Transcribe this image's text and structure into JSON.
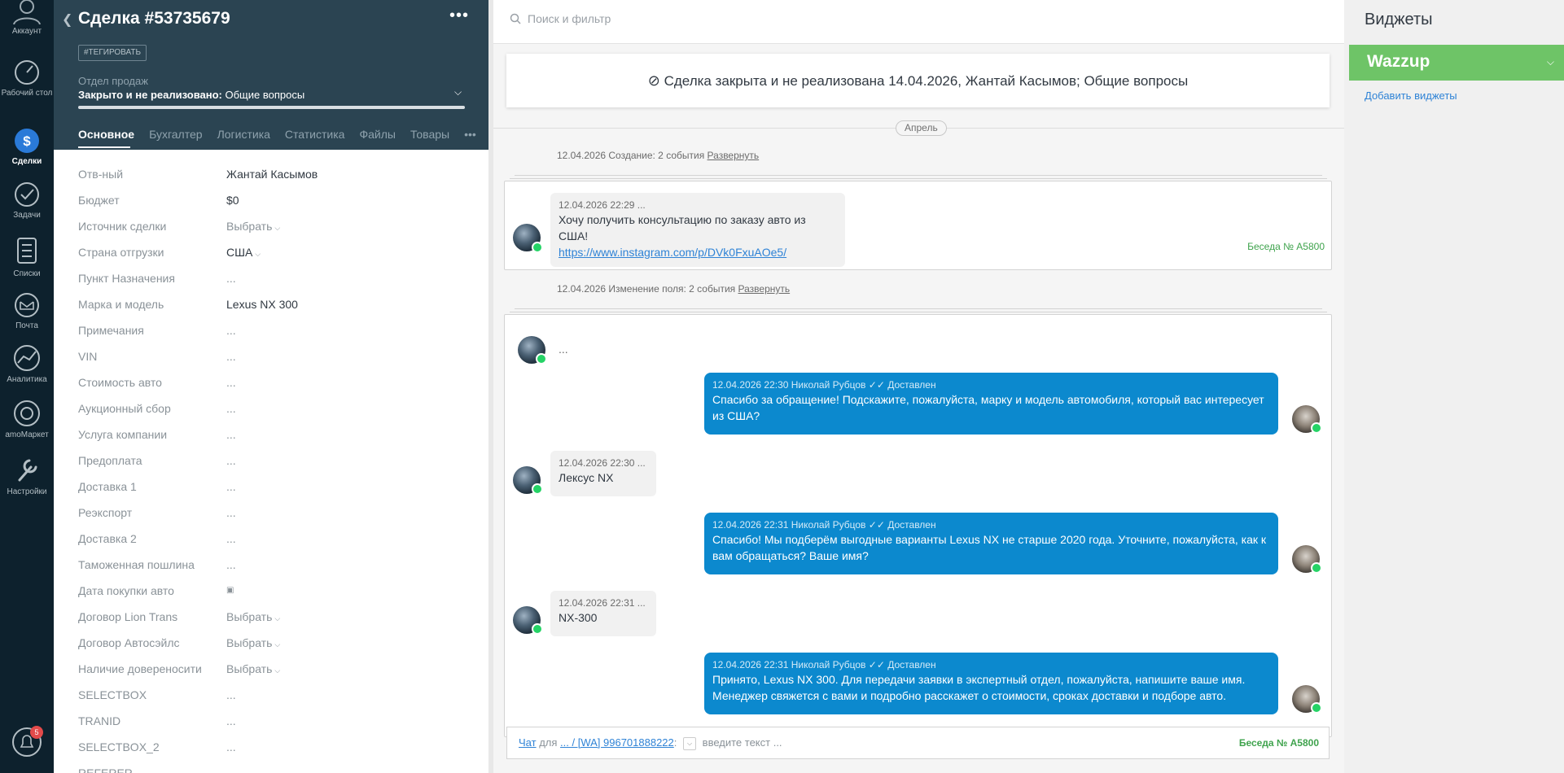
{
  "nav": {
    "items": [
      {
        "label": "Аккаунт"
      },
      {
        "label": "Рабочий стол"
      },
      {
        "label": "Сделки"
      },
      {
        "label": "Задачи"
      },
      {
        "label": "Списки"
      },
      {
        "label": "Почта"
      },
      {
        "label": "Аналитика"
      },
      {
        "label": "amoМаркет"
      },
      {
        "label": "Настройки"
      }
    ],
    "notifications_count": "5"
  },
  "card": {
    "title": "Сделка #53735679",
    "tag_button": "#ТЕГИРОВАТЬ",
    "pipeline": "Отдел продаж",
    "status_bold": "Закрыто и не реализовано:",
    "status_rest": " Общие вопросы",
    "tabs": [
      "Основное",
      "Бухгалтер",
      "Логистика",
      "Статистика",
      "Файлы",
      "Товары"
    ],
    "fields": [
      {
        "label": "Отв-ный",
        "value": "Жантай Касымов"
      },
      {
        "label": "Бюджет",
        "value": "$0"
      },
      {
        "label": "Источник сделки",
        "value": "Выбрать"
      },
      {
        "label": "Страна отгрузки",
        "value": "США"
      },
      {
        "label": "Пункт Назначения",
        "value": "..."
      },
      {
        "label": "Марка и модель",
        "value": "Lexus NX 300"
      },
      {
        "label": "Примечания",
        "value": "..."
      },
      {
        "label": "VIN",
        "value": "..."
      },
      {
        "label": "Стоимость авто",
        "value": "..."
      },
      {
        "label": "Аукционный сбор",
        "value": "..."
      },
      {
        "label": "Услуга компании",
        "value": "..."
      },
      {
        "label": "Предоплата",
        "value": "..."
      },
      {
        "label": "Доставка 1",
        "value": "..."
      },
      {
        "label": "Реэкспорт",
        "value": "..."
      },
      {
        "label": "Доставка 2",
        "value": "..."
      },
      {
        "label": "Таможенная пошлина",
        "value": "..."
      },
      {
        "label": "Дата покупки авто",
        "value": ""
      },
      {
        "label": "Договор Lion Trans",
        "value": "Выбрать"
      },
      {
        "label": "Договор Автосэйлс",
        "value": "Выбрать"
      },
      {
        "label": "Наличие довереносити",
        "value": "Выбрать"
      },
      {
        "label": "SELECTBOX",
        "value": "..."
      },
      {
        "label": "TRANID",
        "value": "..."
      },
      {
        "label": "SELECTBOX_2",
        "value": "..."
      },
      {
        "label": "REFERER",
        "value": ""
      }
    ]
  },
  "feed": {
    "search_placeholder": "Поиск и фильтр",
    "closed_banner": "Сделка закрыта и не реализована 14.04.2026, Жантай Касымов; Общие вопросы",
    "month": "Апрель",
    "summary1_text": "12.04.2026 Создание: 2 события",
    "summary2_text": "12.04.2026 Изменение поля: 2 события",
    "expand": "Развернуть",
    "conversation": "Беседа № A5800",
    "ellipsis": "...",
    "msg1": {
      "meta": "12.04.2026 22:29 ...",
      "text": "Хочу получить консультацию по заказу авто из США!",
      "link": "https://www.instagram.com/p/DVk0FxuAOe5/"
    },
    "out1": {
      "meta": "12.04.2026 22:30 Николай Рубцов",
      "status": "Доставлен",
      "text": "Спасибо за обращение! Подскажите, пожалуйста, марку и модель автомобиля, который вас интересует из США?"
    },
    "in2": {
      "meta": "12.04.2026 22:30 ...",
      "text": "Лексус NX"
    },
    "out2": {
      "meta": "12.04.2026 22:31 Николай Рубцов",
      "status": "Доставлен",
      "text": "Спасибо! Мы подберём выгодные варианты Lexus NX не старше 2020 года. Уточните, пожалуйста, как к вам обращаться? Ваше имя?"
    },
    "in3": {
      "meta": "12.04.2026 22:31 ...",
      "text": "NX-300"
    },
    "out3": {
      "meta": "12.04.2026 22:31 Николай Рубцов",
      "status": "Доставлен",
      "text": "Принято, Lexus NX 300. Для передачи заявки в экспертный отдел, пожалуйста, напишите ваше имя. Менеджер свяжется с вами и подробно расскажет о стоимости, сроках доставки и подборе авто."
    },
    "chat": {
      "chat_link": "Чат",
      "for": "для",
      "contact_link": "... / [WA] 996701888222",
      "colon": ":",
      "placeholder": "введите текст ..."
    }
  },
  "widgets": {
    "title": "Виджеты",
    "wazzup": "Wazzup",
    "add": "Добавить виджеты"
  },
  "colors": {
    "nav_bg": "#0d212d",
    "card_header": "#2b4452",
    "out_bubble": "#0c89ce",
    "wazzup": "#6ec467",
    "conversation_green": "#3fa34d"
  }
}
